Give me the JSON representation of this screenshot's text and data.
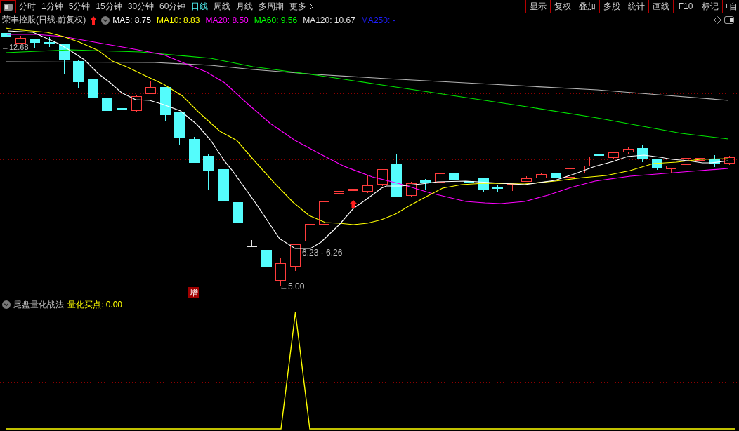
{
  "toolbar": {
    "tabs": [
      {
        "label": "分时",
        "selected": false,
        "dropdown": false
      },
      {
        "label": "1分钟",
        "selected": false,
        "dropdown": false
      },
      {
        "label": "5分钟",
        "selected": false,
        "dropdown": false
      },
      {
        "label": "15分钟",
        "selected": false,
        "dropdown": false
      },
      {
        "label": "30分钟",
        "selected": false,
        "dropdown": false
      },
      {
        "label": "60分钟",
        "selected": false,
        "dropdown": false
      },
      {
        "label": "日线",
        "selected": true,
        "dropdown": false
      },
      {
        "label": "周线",
        "selected": false,
        "dropdown": false
      },
      {
        "label": "月线",
        "selected": false,
        "dropdown": false
      },
      {
        "label": "多周期",
        "selected": false,
        "dropdown": false
      },
      {
        "label": "更多",
        "selected": false,
        "dropdown": true
      }
    ],
    "buttons": [
      "显示",
      "复权",
      "叠加",
      "多股",
      "统计",
      "画线",
      "F10",
      "标记",
      "+自"
    ]
  },
  "main_chart": {
    "title": "荣丰控股(日线.前复权)",
    "legend": [
      {
        "label": "MA5: 8.75",
        "color": "#ffffff"
      },
      {
        "label": "MA10: 8.83",
        "color": "#ffff00"
      },
      {
        "label": "MA20: 8.50",
        "color": "#ff00ff"
      },
      {
        "label": "MA60: 9.56",
        "color": "#00ff00"
      },
      {
        "label": "MA120: 10.67",
        "color": "#e6e6e6"
      },
      {
        "label": "MA250: -",
        "color": "#1e1eff"
      }
    ],
    "annotations": [
      "←12.68",
      "6.23 - 6.26",
      "←5.00"
    ],
    "badge": "增"
  },
  "indicator_panel": {
    "title": "尾盘量化战法",
    "reading": "量化买点: 0.00"
  }
}
